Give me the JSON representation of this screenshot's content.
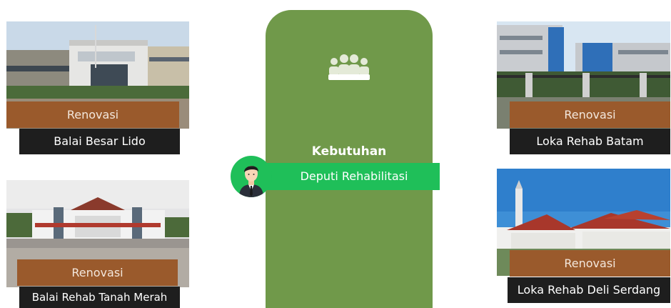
{
  "hub": {
    "title": "Kebutuhan",
    "subtitle": "Deputi Rehabilitasi"
  },
  "facilities": [
    {
      "tag": "Renovasi",
      "name": "Balai Besar Lido"
    },
    {
      "tag": "Renovasi",
      "name": "Balai Rehab Tanah Merah"
    },
    {
      "tag": "Renovasi",
      "name": "Loka Rehab Batam"
    },
    {
      "tag": "Renovasi",
      "name": "Loka Rehab Deli Serdang"
    }
  ],
  "colors": {
    "hub": "#70994a",
    "accent": "#1fbf59",
    "tag": "#9a5a2c",
    "name_bar": "#1e1e1e"
  },
  "icons": [
    "people-group-icon",
    "businessman-avatar-icon"
  ]
}
